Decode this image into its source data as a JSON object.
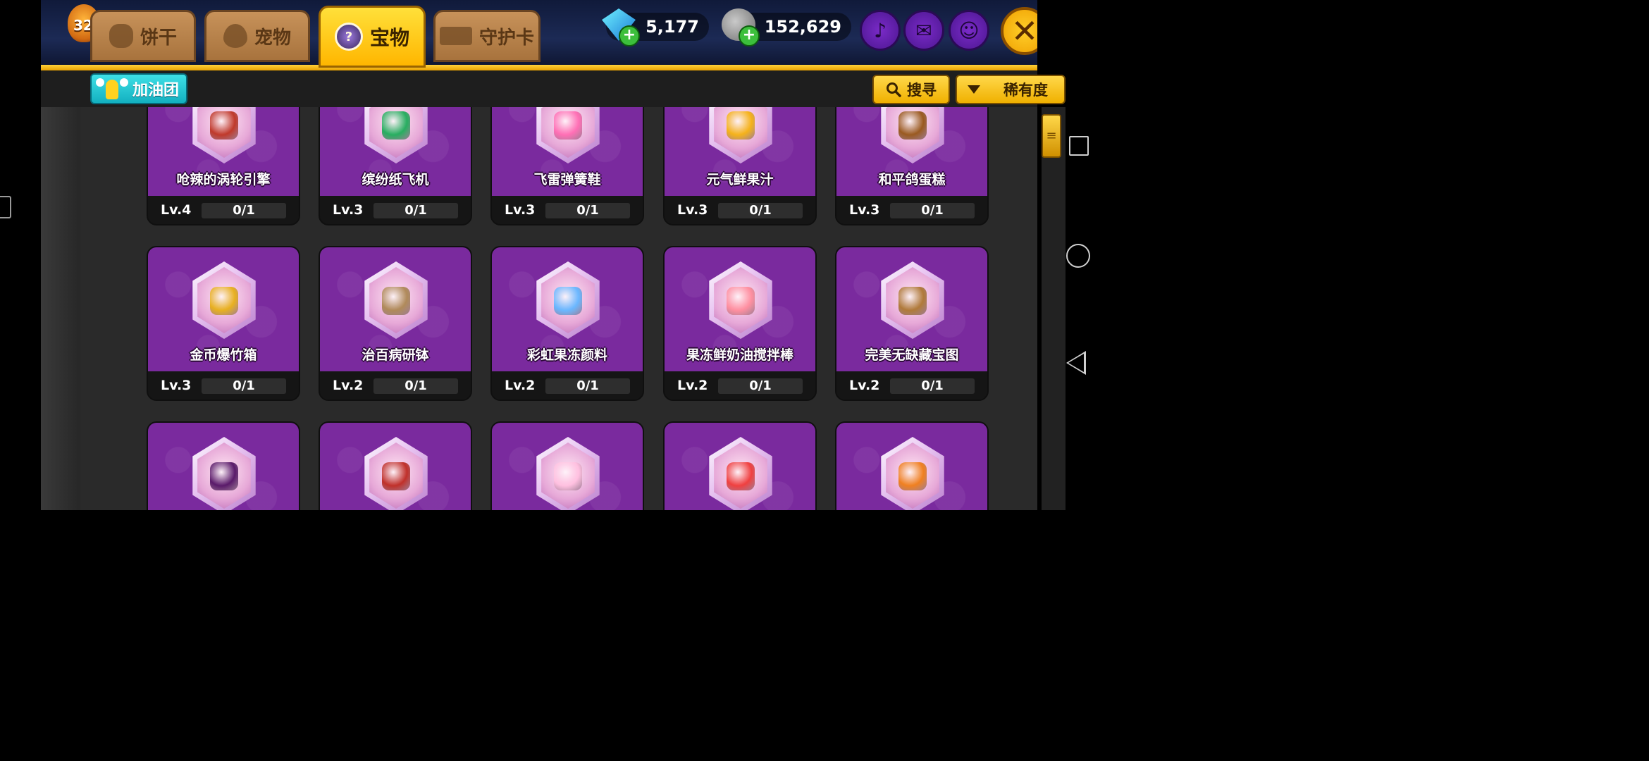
{
  "profile": {
    "level_badge": "32"
  },
  "tabs": [
    {
      "id": "cookie",
      "label": "饼干",
      "active": false
    },
    {
      "id": "pet",
      "label": "宠物",
      "active": false
    },
    {
      "id": "treasure",
      "label": "宝物",
      "active": true
    },
    {
      "id": "card",
      "label": "守护卡",
      "active": false
    }
  ],
  "currency": {
    "crystals": "5,177",
    "coins": "152,629",
    "plus": "+"
  },
  "top_buttons": {
    "close": "✕",
    "bell": "♪",
    "mail": "✉",
    "friends": "☺"
  },
  "filters": {
    "cheer": "加油团",
    "search": "搜寻",
    "sort": "稀有度"
  },
  "colors": {
    "card_purple": "#7a2a9e",
    "tab_active": "#ffc81a",
    "accent_cyan": "#22c8d6"
  },
  "treasures": [
    {
      "name": "呛辣的涡轮引擎",
      "level": "Lv.4",
      "count": "0/1",
      "icon": "turbo-engine-icon",
      "color": "#c0392b"
    },
    {
      "name": "缤纷纸飞机",
      "level": "Lv.3",
      "count": "0/1",
      "icon": "paper-plane-icon",
      "color": "#27ae60"
    },
    {
      "name": "飞雷弹簧鞋",
      "level": "Lv.3",
      "count": "0/1",
      "icon": "spring-shoe-icon",
      "color": "#ff6fb5"
    },
    {
      "name": "元气鲜果汁",
      "level": "Lv.3",
      "count": "0/1",
      "icon": "fruit-juice-icon",
      "color": "#f5b21a"
    },
    {
      "name": "和平鸽蛋糕",
      "level": "Lv.3",
      "count": "0/1",
      "icon": "dove-cake-icon",
      "color": "#9a5a20"
    },
    {
      "name": "金币爆竹箱",
      "level": "Lv.3",
      "count": "0/1",
      "icon": "coin-firecracker-box-icon",
      "color": "#e8b020"
    },
    {
      "name": "治百病研钵",
      "level": "Lv.2",
      "count": "0/1",
      "icon": "mortar-icon",
      "color": "#b08a5a"
    },
    {
      "name": "彩虹果冻颜料",
      "level": "Lv.2",
      "count": "0/1",
      "icon": "rainbow-paint-icon",
      "color": "#6ab7ff"
    },
    {
      "name": "果冻鲜奶油搅拌棒",
      "level": "Lv.2",
      "count": "0/1",
      "icon": "whisk-icon",
      "color": "#ff8fa0"
    },
    {
      "name": "完美无缺藏宝图",
      "level": "Lv.2",
      "count": "0/1",
      "icon": "treasure-map-icon",
      "color": "#b07a3a"
    },
    {
      "name": "",
      "level": "",
      "count": "",
      "icon": "dark-feather-icon",
      "color": "#5a1a6a"
    },
    {
      "name": "",
      "level": "",
      "count": "",
      "icon": "red-book-icon",
      "color": "#c0302a"
    },
    {
      "name": "",
      "level": "",
      "count": "",
      "icon": "rainbow-ice-cream-icon",
      "color": "#ffc0e0"
    },
    {
      "name": "",
      "level": "",
      "count": "",
      "icon": "bear-lifebuoy-icon",
      "color": "#f04040"
    },
    {
      "name": "",
      "level": "",
      "count": "",
      "icon": "orange-potion-icon",
      "color": "#f08020"
    }
  ]
}
